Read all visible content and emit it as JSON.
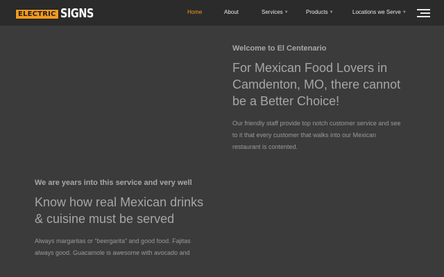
{
  "logo": {
    "box_text": "ELECTRIC",
    "word_text": "SIGNS"
  },
  "nav": {
    "items": [
      {
        "label": "Home",
        "active": true,
        "has_dropdown": false
      },
      {
        "label": "About",
        "active": false,
        "has_dropdown": false
      },
      {
        "label": "Services",
        "active": false,
        "has_dropdown": true
      },
      {
        "label": "Products",
        "active": false,
        "has_dropdown": true
      },
      {
        "label": "Locations we Serve",
        "active": false,
        "has_dropdown": true
      }
    ],
    "menu_icon": "hamburger-icon",
    "dropdown_icon": "chevron-down-icon"
  },
  "section_welcome": {
    "kicker": "Welcome to El Centenario",
    "headline": "For Mexican Food Lovers in Camdenton, MO, there cannot be a Better Choice!",
    "body": "Our friendly staff provide top notch customer service and see to it that every customer that walks into our Mexican restaurant is contented."
  },
  "section_service": {
    "kicker": "We are years into this service and very well",
    "headline": "Know how real Mexican drinks & cuisine must be served",
    "body": "Always margaritas or “beergarita” and good food. Fajitas always good. Guacamole is awesome with avocado and"
  },
  "colors": {
    "accent": "#f39a1d",
    "header_bg": "#2b2b2b",
    "page_bg": "#3b3b3b"
  }
}
